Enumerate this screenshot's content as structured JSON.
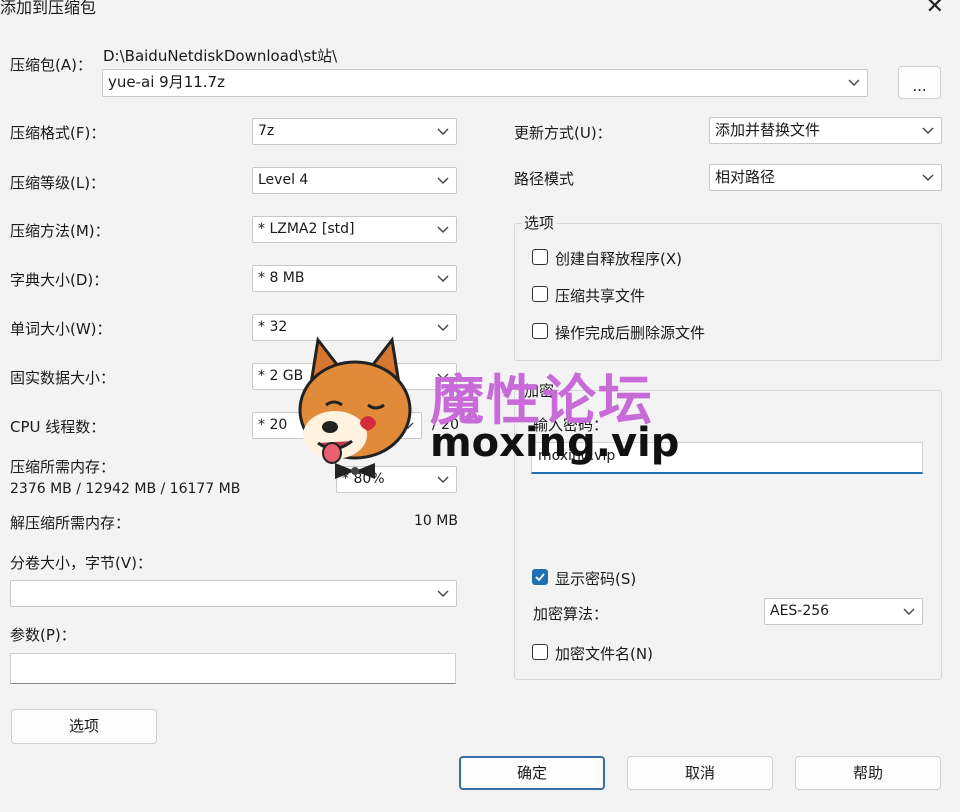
{
  "window": {
    "title": "添加到压缩包",
    "close_glyph": "✕"
  },
  "archive": {
    "label": "压缩包(A)：",
    "path": "D:\\BaiduNetdiskDownload\\st站\\",
    "filename": "yue-ai 9月11.7z",
    "browse_label": "..."
  },
  "left": {
    "format": {
      "label": "压缩格式(F)：",
      "value": "7z"
    },
    "level": {
      "label": "压缩等级(L)：",
      "value": "Level 4"
    },
    "method": {
      "label": "压缩方法(M)：",
      "value": "* LZMA2 [std]"
    },
    "dict": {
      "label": "字典大小(D)：",
      "value": "* 8 MB"
    },
    "word": {
      "label": "单词大小(W)：",
      "value": "* 32"
    },
    "solid": {
      "label": "固实数据大小：",
      "value": "* 2 GB"
    },
    "threads": {
      "label": "CPU 线程数：",
      "value": "* 20",
      "max": "/ 20"
    },
    "memory": {
      "label": "压缩所需内存：",
      "detail": "2376 MB / 12942 MB / 16177 MB",
      "value": "* 80%"
    },
    "decomp": {
      "label": "解压缩所需内存：",
      "value": "10 MB"
    },
    "volume": {
      "label": "分卷大小，字节(V)：",
      "value": ""
    },
    "params": {
      "label": "参数(P)：",
      "value": ""
    },
    "options_button": "选项"
  },
  "right": {
    "update": {
      "label": "更新方式(U)：",
      "value": "添加并替换文件"
    },
    "pathmode": {
      "label": "路径模式",
      "value": "相对路径"
    },
    "options": {
      "title": "选项",
      "items": [
        {
          "label": "创建自释放程序(X)",
          "checked": false
        },
        {
          "label": "压缩共享文件",
          "checked": false
        },
        {
          "label": "操作完成后删除源文件",
          "checked": false
        }
      ]
    },
    "encryption": {
      "title": "加密",
      "password_label": "输入密码：",
      "password_value": "moxing.vip",
      "show_password": {
        "label": "显示密码(S)",
        "checked": true
      },
      "method_label": "加密算法：",
      "method_value": "AES-256",
      "encrypt_names": {
        "label": "加密文件名(N)",
        "checked": false
      }
    }
  },
  "footer": {
    "ok": "确定",
    "cancel": "取消",
    "help": "帮助"
  },
  "watermark": {
    "cn": "魔性论坛",
    "domain": "moxing.vip",
    "cn_color": "#c86ad8",
    "domain_color": "#111111"
  },
  "colors": {
    "accent": "#1f6fb2",
    "primary_border": "#3a6ea5"
  }
}
